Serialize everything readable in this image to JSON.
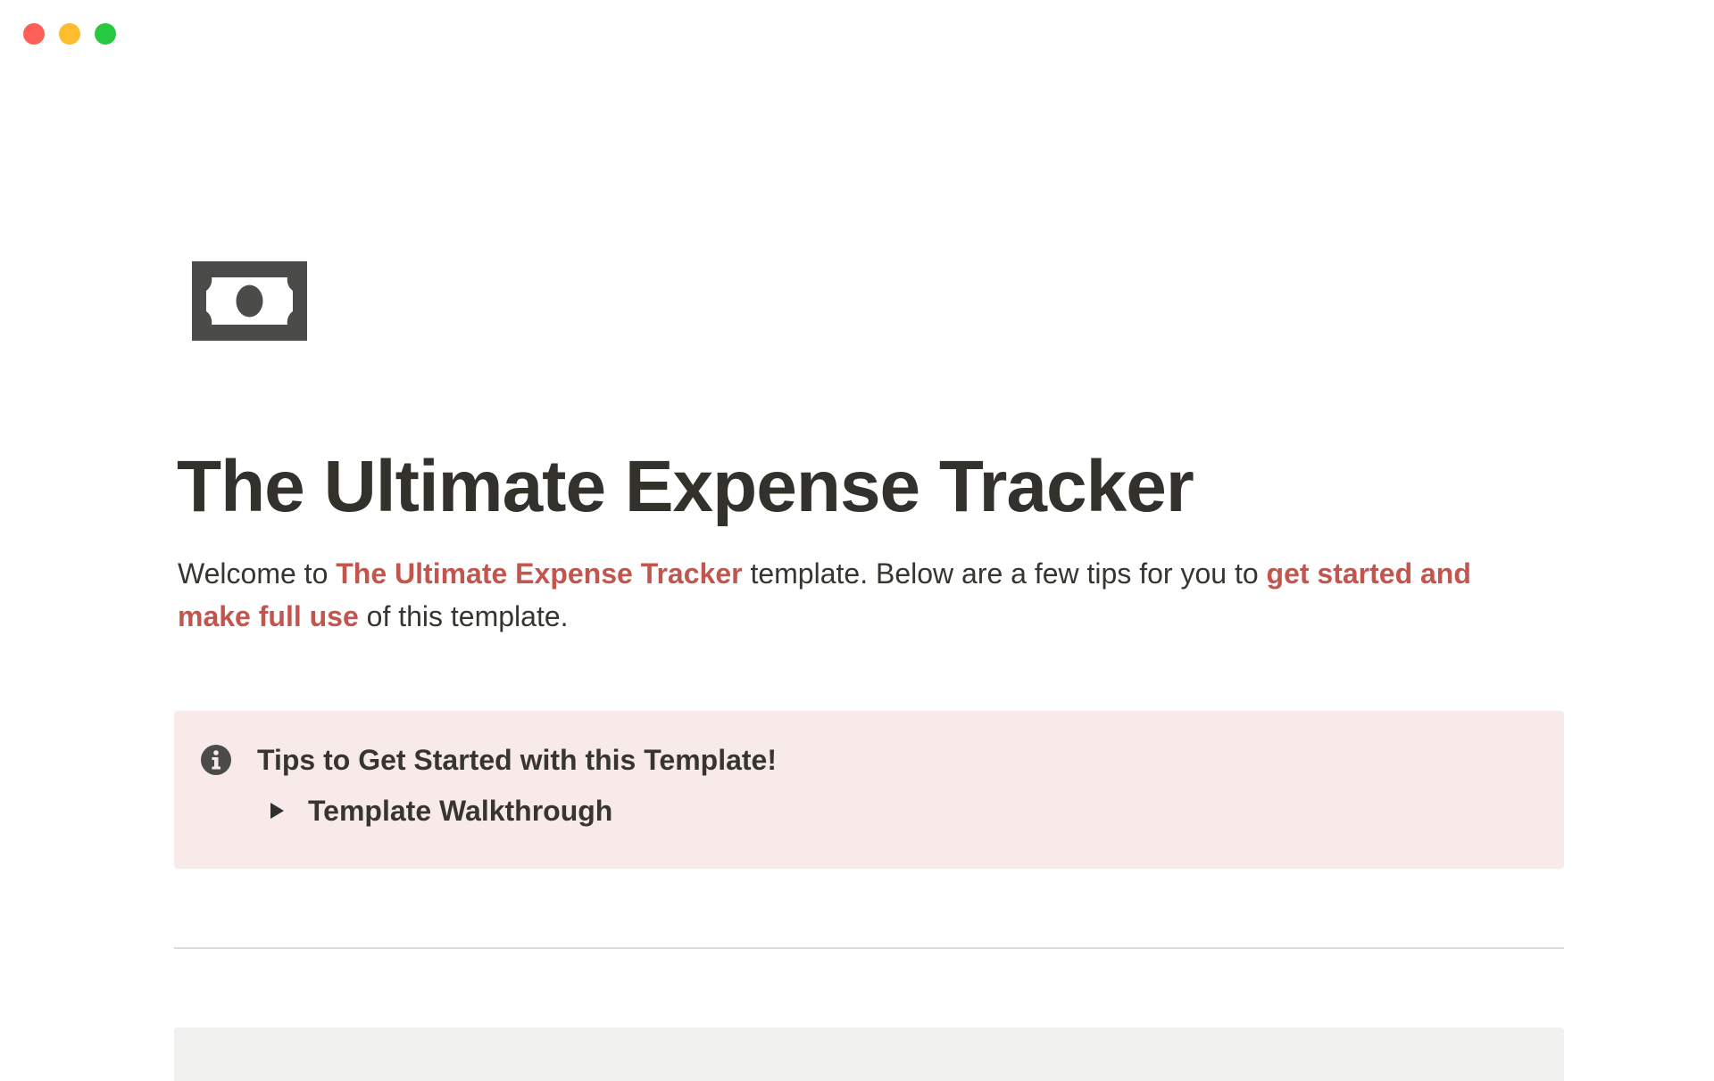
{
  "window": {
    "controls": {
      "close_color": "#ff5f57",
      "minimize_color": "#febc2e",
      "zoom_color": "#28c840"
    }
  },
  "page": {
    "icon": "dollar-bill-icon",
    "title": "The Ultimate Expense Tracker",
    "intro": {
      "part1": "Welcome to ",
      "highlight1": "The Ultimate Expense Tracker",
      "part2": " template. Below are a few tips for you to ",
      "highlight2": "get started and make full use",
      "part3": " of this template.",
      "highlight_color": "#c4554d"
    },
    "callout": {
      "icon": "info-icon",
      "background": "#f9eaea",
      "heading": "Tips to Get Started with this Template!",
      "toggle": {
        "icon": "triangle-right-icon",
        "label": "Template Walkthrough"
      }
    }
  }
}
